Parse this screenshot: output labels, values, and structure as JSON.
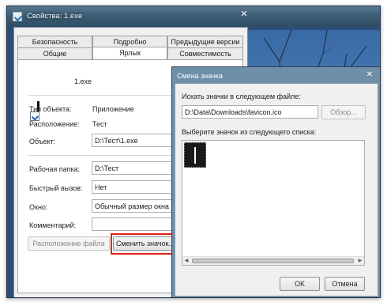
{
  "window": {
    "title": "Свойства: 1.exe",
    "close_glyph": "✕"
  },
  "tabs": {
    "row1": [
      "Безопасность",
      "Подробно",
      "Предыдущие версии"
    ],
    "row2": [
      "Общие",
      "Ярлык",
      "Совместимость"
    ],
    "active": "Ярлык"
  },
  "shortcut": {
    "file_name": "1.exe",
    "type_label": "Тип объекта:",
    "type_value": "Приложение",
    "location_label": "Расположение:",
    "location_value": "Тест",
    "target_label": "Объект:",
    "target_value": "D:\\Тест\\1.exe",
    "start_in_label": "Рабочая папка:",
    "start_in_value": "D:\\Тест",
    "hotkey_label": "Быстрый вызов:",
    "hotkey_value": "Нет",
    "run_label": "Окно:",
    "run_value": "Обычный размер окна",
    "comment_label": "Комментарий:",
    "comment_value": "",
    "open_location_button": "Расположение файла",
    "change_icon_button": "Сменить значок...",
    "highlight_color": "#e0201b"
  },
  "dialog": {
    "title": "Смена значка",
    "close_glyph": "✕",
    "search_label": "Искать значки в следующем файле:",
    "file_path": "D:\\Data\\Downloads\\favicon.ico",
    "browse_button": "Обзор...",
    "list_label": "Выберите значок из следующего списка:",
    "ok_button": "OK",
    "cancel_button": "Отмена"
  }
}
